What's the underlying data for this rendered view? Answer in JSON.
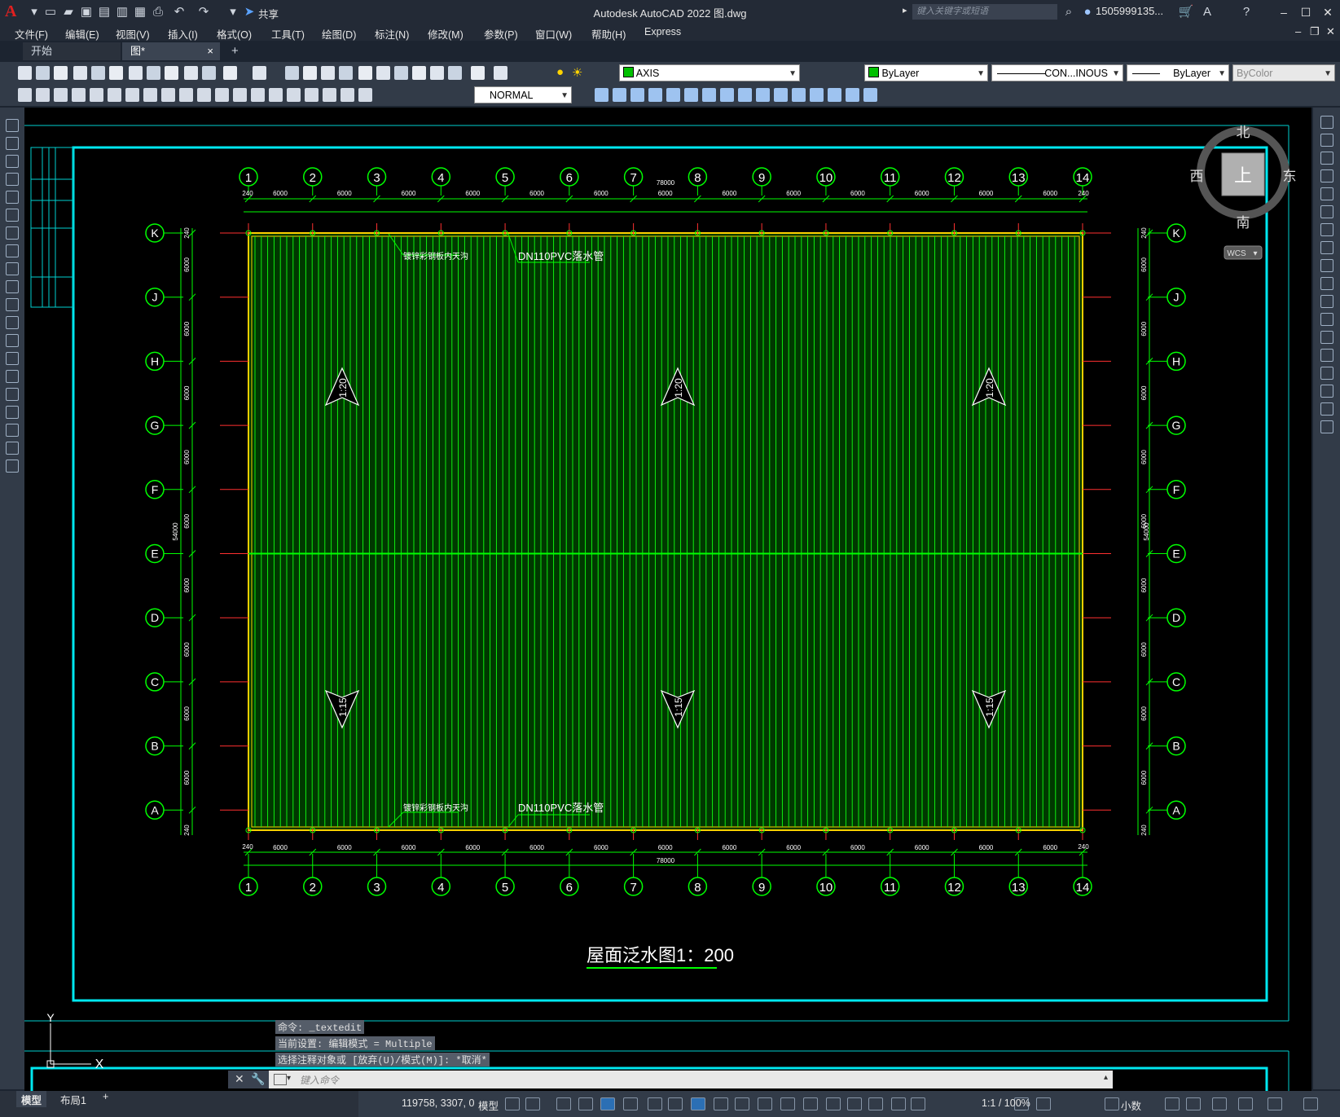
{
  "app": {
    "title": "Autodesk AutoCAD 2022    图.dwg",
    "logo": "A",
    "share_label": "共享",
    "search_placeholder": "键入关键字或短语",
    "user": "1505999135..."
  },
  "menus": [
    "文件(F)",
    "编辑(E)",
    "视图(V)",
    "插入(I)",
    "格式(O)",
    "工具(T)",
    "绘图(D)",
    "标注(N)",
    "修改(M)",
    "参数(P)",
    "窗口(W)",
    "帮助(H)",
    "Express"
  ],
  "tabs": {
    "start": "开始",
    "drawing": "图*",
    "close": "×",
    "add": "+"
  },
  "properties": {
    "layer": "AXIS",
    "color": "ByLayer",
    "linetype": "CON...INOUS",
    "lineweight": "ByLayer",
    "plotstyle": "ByColor",
    "dimstyle": "NORMAL"
  },
  "viewcube": {
    "north": "北",
    "south": "南",
    "east": "东",
    "west": "西",
    "top": "上",
    "wcs": "WCS"
  },
  "drawing": {
    "col_labels": [
      "1",
      "2",
      "3",
      "4",
      "5",
      "6",
      "7",
      "8",
      "9",
      "10",
      "11",
      "12",
      "13",
      "14"
    ],
    "row_labels": [
      "K",
      "J",
      "H",
      "G",
      "F",
      "E",
      "D",
      "C",
      "B",
      "A"
    ],
    "bay_dim": "6000",
    "edge_dim": "240",
    "total_x": "78000",
    "total_y": "54000",
    "notes": {
      "top_left": "镀锌彩钢板内天沟",
      "top_pipe": "DN110PVC落水管",
      "bottom_left": "镀锌彩钢板内天沟",
      "bottom_pipe": "DN110PVC落水管"
    },
    "slope_up": "1:20",
    "slope_down": "1:15",
    "title": "屋面泛水图1：200",
    "ucs_y": "Y",
    "ucs_x": "X"
  },
  "command": {
    "history": [
      "命令: _textedit",
      "当前设置: 编辑模式 = Multiple",
      "选择注释对象或 [放弃(U)/模式(M)]: *取消*"
    ],
    "placeholder": "键入命令"
  },
  "status": {
    "model_tab": "模型",
    "layout_tab": "布局1",
    "coords": "119758, 3307, 0",
    "space": "模型",
    "scale": "1:1 / 100%",
    "units": "小数"
  }
}
